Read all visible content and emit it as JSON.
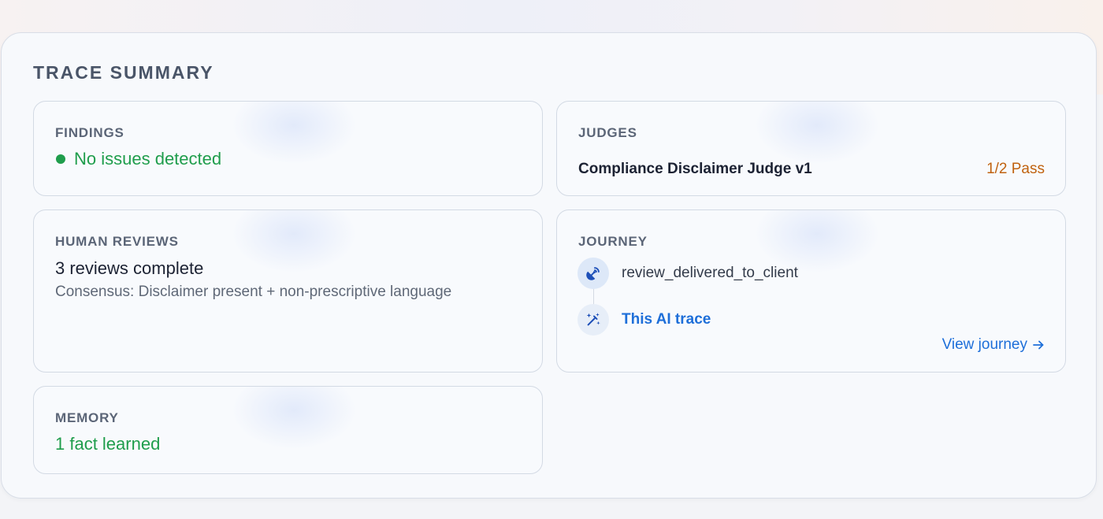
{
  "panel": {
    "title": "TRACE SUMMARY"
  },
  "findings": {
    "label": "FINDINGS",
    "status": "No issues detected",
    "status_color": "#1f9d4c"
  },
  "judges": {
    "label": "JUDGES",
    "items": [
      {
        "name": "Compliance Disclaimer Judge v1",
        "result": "1/2 Pass",
        "result_color": "#c0620f"
      }
    ]
  },
  "human_reviews": {
    "label": "HUMAN REVIEWS",
    "count_text": "3 reviews complete",
    "consensus": "Consensus: Disclaimer present + non-prescriptive language"
  },
  "journey": {
    "label": "JOURNEY",
    "steps": [
      {
        "label": "review_delivered_to_client",
        "icon": "satellite-dish-icon"
      },
      {
        "label": "This AI trace",
        "icon": "magic-wand-sparkles-icon",
        "current": true
      }
    ],
    "view_link": "View journey",
    "link_icon": "arrow-right-icon",
    "accent": "#1e6fd9"
  },
  "memory": {
    "label": "MEMORY",
    "value": "1 fact learned"
  }
}
